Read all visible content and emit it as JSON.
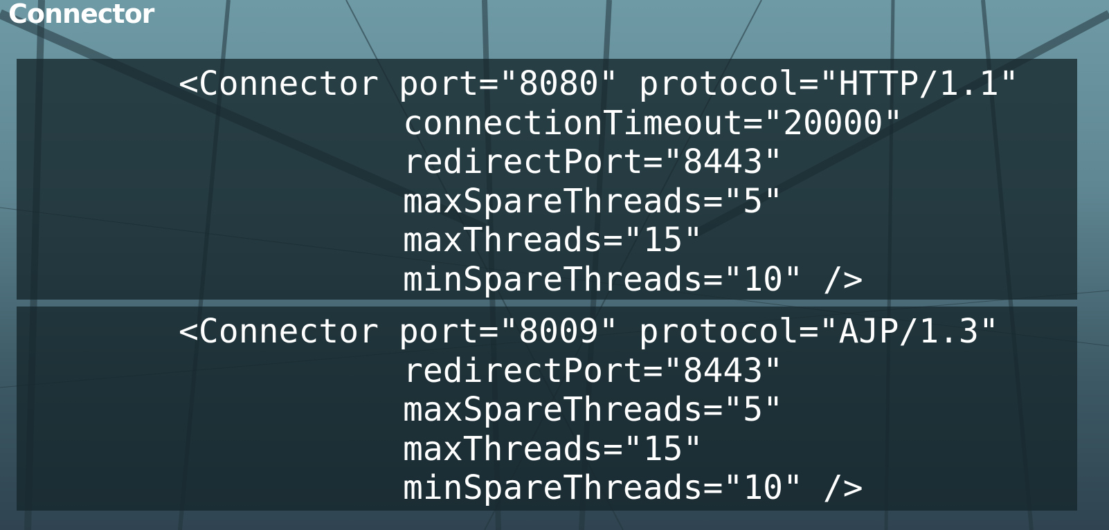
{
  "slide": {
    "title": "Connector",
    "blocks": [
      {
        "lines": [
          "<Connector port=\"8080\" protocol=\"HTTP/1.1\"",
          "connectionTimeout=\"20000\"",
          "redirectPort=\"8443\"",
          "maxSpareThreads=\"5\"",
          "maxThreads=\"15\"",
          "minSpareThreads=\"10\" />"
        ]
      },
      {
        "lines": [
          "<Connector port=\"8009\" protocol=\"AJP/1.3\"",
          "redirectPort=\"8443\"",
          "maxSpareThreads=\"5\"",
          "maxThreads=\"15\"",
          "minSpareThreads=\"10\" />"
        ]
      }
    ]
  }
}
